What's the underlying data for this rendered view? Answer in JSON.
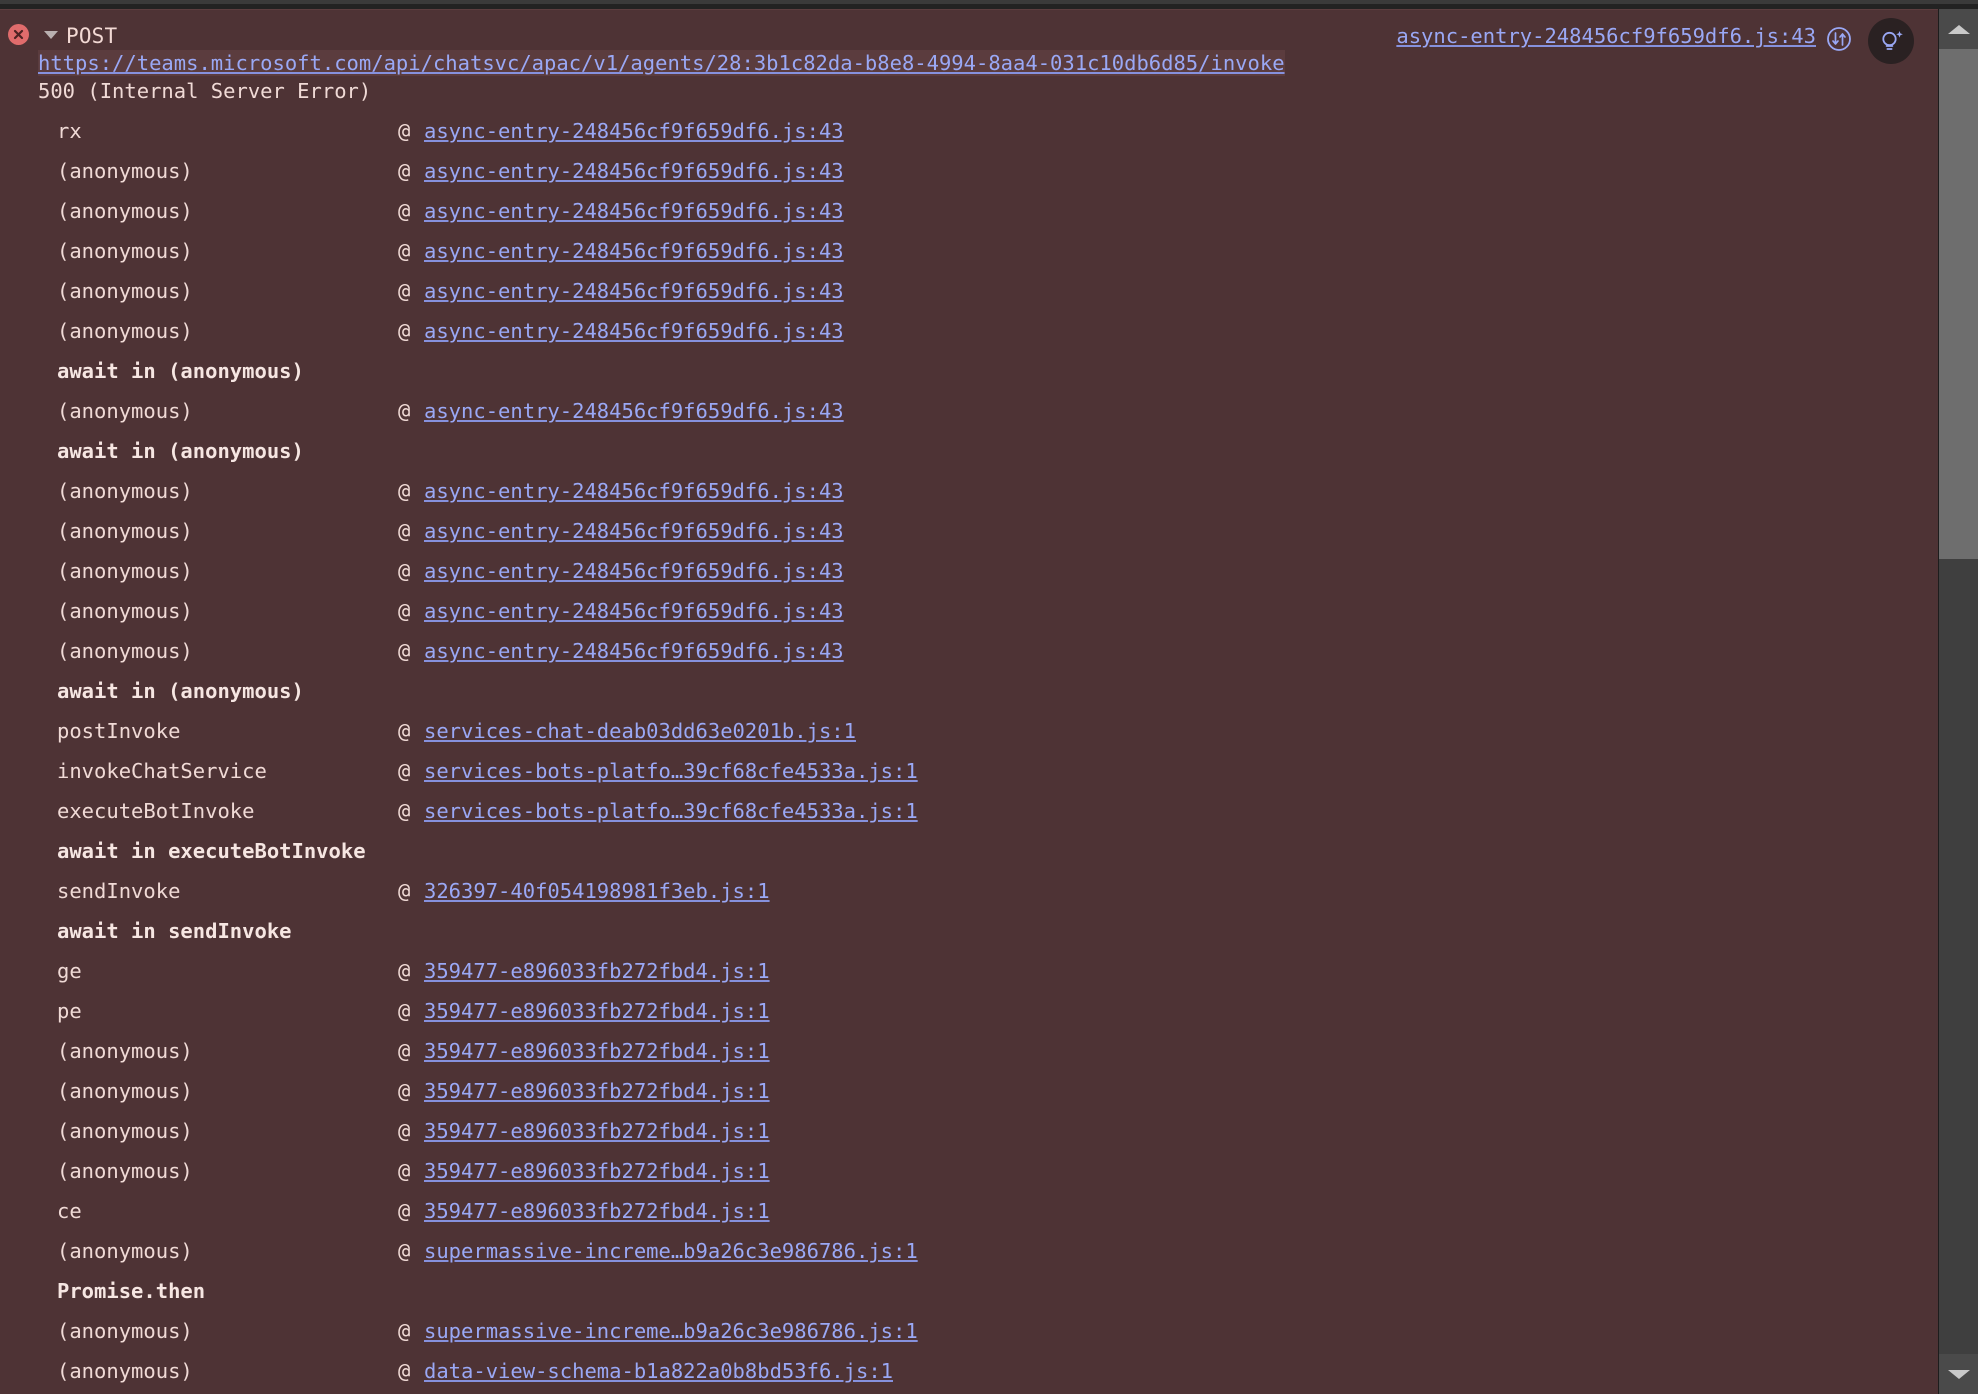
{
  "theme": {
    "error_background": "#4e3335",
    "text_color": "#f0dad6",
    "link_color": "#9aa8f5",
    "error_badge_color": "#e06c6c",
    "devtools_chrome": "#282828"
  },
  "console_message": {
    "severity": "error",
    "error_icon": "error-circle-x-icon",
    "disclosure_icon": "triangle-down-icon",
    "expanded": true,
    "method": "POST",
    "url": "https://teams.microsoft.com/api/chatsvc/apac/v1/agents/28:3b1c82da-b8e8-4994-8aa4-031c10db6d85/invoke",
    "status": "500 (Internal Server Error)",
    "origin_link": "async-entry-248456cf9f659df6.js:43",
    "network_icon": "network-request-icon",
    "ai_icon": "ai-lightbulb-icon",
    "at_symbol": "@"
  },
  "stack_frames": [
    {
      "type": "frame",
      "fn": "rx",
      "source": "async-entry-248456cf9f659df6.js:43"
    },
    {
      "type": "frame",
      "fn": "(anonymous)",
      "source": "async-entry-248456cf9f659df6.js:43"
    },
    {
      "type": "frame",
      "fn": "(anonymous)",
      "source": "async-entry-248456cf9f659df6.js:43"
    },
    {
      "type": "frame",
      "fn": "(anonymous)",
      "source": "async-entry-248456cf9f659df6.js:43"
    },
    {
      "type": "frame",
      "fn": "(anonymous)",
      "source": "async-entry-248456cf9f659df6.js:43"
    },
    {
      "type": "frame",
      "fn": "(anonymous)",
      "source": "async-entry-248456cf9f659df6.js:43"
    },
    {
      "type": "async",
      "fn": "await in (anonymous)",
      "source": ""
    },
    {
      "type": "frame",
      "fn": "(anonymous)",
      "source": "async-entry-248456cf9f659df6.js:43"
    },
    {
      "type": "async",
      "fn": "await in (anonymous)",
      "source": ""
    },
    {
      "type": "frame",
      "fn": "(anonymous)",
      "source": "async-entry-248456cf9f659df6.js:43"
    },
    {
      "type": "frame",
      "fn": "(anonymous)",
      "source": "async-entry-248456cf9f659df6.js:43"
    },
    {
      "type": "frame",
      "fn": "(anonymous)",
      "source": "async-entry-248456cf9f659df6.js:43"
    },
    {
      "type": "frame",
      "fn": "(anonymous)",
      "source": "async-entry-248456cf9f659df6.js:43"
    },
    {
      "type": "frame",
      "fn": "(anonymous)",
      "source": "async-entry-248456cf9f659df6.js:43"
    },
    {
      "type": "async",
      "fn": "await in (anonymous)",
      "source": ""
    },
    {
      "type": "frame",
      "fn": "postInvoke",
      "source": "services-chat-deab03dd63e0201b.js:1"
    },
    {
      "type": "frame",
      "fn": "invokeChatService",
      "source": "services-bots-platfo…39cf68cfe4533a.js:1"
    },
    {
      "type": "frame",
      "fn": "executeBotInvoke",
      "source": "services-bots-platfo…39cf68cfe4533a.js:1"
    },
    {
      "type": "async",
      "fn": "await in executeBotInvoke",
      "source": ""
    },
    {
      "type": "frame",
      "fn": "sendInvoke",
      "source": "326397-40f054198981f3eb.js:1"
    },
    {
      "type": "async",
      "fn": "await in sendInvoke",
      "source": ""
    },
    {
      "type": "frame",
      "fn": "ge",
      "source": "359477-e896033fb272fbd4.js:1"
    },
    {
      "type": "frame",
      "fn": "pe",
      "source": "359477-e896033fb272fbd4.js:1"
    },
    {
      "type": "frame",
      "fn": "(anonymous)",
      "source": "359477-e896033fb272fbd4.js:1"
    },
    {
      "type": "frame",
      "fn": "(anonymous)",
      "source": "359477-e896033fb272fbd4.js:1"
    },
    {
      "type": "frame",
      "fn": "(anonymous)",
      "source": "359477-e896033fb272fbd4.js:1"
    },
    {
      "type": "frame",
      "fn": "(anonymous)",
      "source": "359477-e896033fb272fbd4.js:1"
    },
    {
      "type": "frame",
      "fn": "ce",
      "source": "359477-e896033fb272fbd4.js:1"
    },
    {
      "type": "frame",
      "fn": "(anonymous)",
      "source": "supermassive-increme…b9a26c3e986786.js:1"
    },
    {
      "type": "async",
      "fn": "Promise.then",
      "source": ""
    },
    {
      "type": "frame",
      "fn": "(anonymous)",
      "source": "supermassive-increme…b9a26c3e986786.js:1"
    },
    {
      "type": "frame",
      "fn": "(anonymous)",
      "source": "data-view-schema-b1a822a0b8bd53f6.js:1"
    }
  ],
  "scrollbar": {
    "up_arrow_icon": "scroll-up-arrow-icon",
    "down_arrow_icon": "scroll-down-arrow-icon",
    "thumb_position_pct": 0,
    "thumb_size_pct": 38
  }
}
